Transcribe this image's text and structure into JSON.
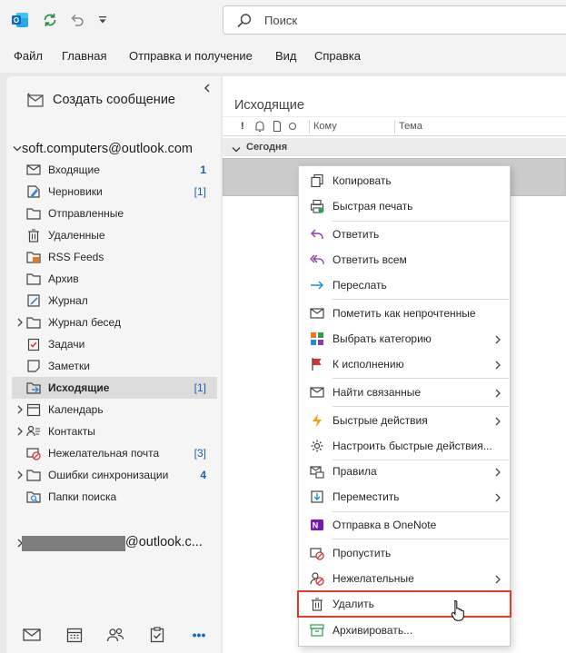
{
  "titlebar": {
    "search_placeholder": "Поиск",
    "icons": [
      "outlook-logo-icon",
      "sync-icon",
      "undo-icon",
      "customize-toolbar-icon"
    ]
  },
  "menu": {
    "items": [
      "Файл",
      "Главная",
      "Отправка и получение",
      "Вид",
      "Справка"
    ]
  },
  "nav": {
    "new_message": "Создать сообщение",
    "account": "soft.computers@outlook.com",
    "folders": [
      {
        "label": "Входящие",
        "count": "1",
        "icon": "inbox-icon"
      },
      {
        "label": "Черновики",
        "count": "[1]",
        "icon": "drafts-icon"
      },
      {
        "label": "Отправленные",
        "count": "",
        "icon": "folder-icon"
      },
      {
        "label": "Удаленные",
        "count": "",
        "icon": "trash-icon"
      },
      {
        "label": "RSS Feeds",
        "count": "",
        "icon": "rss-folder-icon"
      },
      {
        "label": "Архив",
        "count": "",
        "icon": "folder-icon"
      },
      {
        "label": "Журнал",
        "count": "",
        "icon": "journal-icon"
      },
      {
        "label": "Журнал бесед",
        "count": "",
        "icon": "folder-icon"
      },
      {
        "label": "Задачи",
        "count": "",
        "icon": "tasks-icon"
      },
      {
        "label": "Заметки",
        "count": "",
        "icon": "notes-icon"
      },
      {
        "label": "Исходящие",
        "count": "[1]",
        "icon": "outbox-icon"
      },
      {
        "label": "Календарь",
        "count": "",
        "icon": "calendar-icon"
      },
      {
        "label": "Контакты",
        "count": "",
        "icon": "contacts-icon"
      },
      {
        "label": "Нежелательная почта",
        "count": "[3]",
        "icon": "junk-icon"
      },
      {
        "label": "Ошибки синхронизации",
        "count": "4",
        "icon": "folder-icon"
      },
      {
        "label": "Папки поиска",
        "count": "",
        "icon": "search-folder-icon"
      }
    ],
    "second_account_suffix": "@outlook.c...",
    "bottom_icons": [
      "mail-icon",
      "calendar-icon",
      "people-icon",
      "tasks-icon",
      "more-icon"
    ],
    "bottom_more": "•••"
  },
  "list": {
    "title": "Исходящие",
    "columns": {
      "importance": "!",
      "to": "Кому",
      "subject": "Тема"
    },
    "group": "Сегодня"
  },
  "context_menu": {
    "items": [
      {
        "label": "Копировать",
        "icon": "copy-icon"
      },
      {
        "label": "Быстрая печать",
        "icon": "quick-print-icon"
      },
      {
        "label": "Ответить",
        "icon": "reply-icon"
      },
      {
        "label": "Ответить всем",
        "icon": "reply-all-icon"
      },
      {
        "label": "Переслать",
        "icon": "forward-icon"
      },
      {
        "label": "Пометить как непрочтенные",
        "icon": "mark-unread-icon"
      },
      {
        "label": "Выбрать категорию",
        "icon": "categorize-icon"
      },
      {
        "label": "К исполнению",
        "icon": "flag-icon"
      },
      {
        "label": "Найти связанные",
        "icon": "find-related-icon"
      },
      {
        "label": "Быстрые действия",
        "icon": "quick-steps-icon"
      },
      {
        "label": "Настроить быстрые действия...",
        "icon": "gear-icon"
      },
      {
        "label": "Правила",
        "icon": "rules-icon"
      },
      {
        "label": "Переместить",
        "icon": "move-icon"
      },
      {
        "label": "Отправка в OneNote",
        "icon": "onenote-icon"
      },
      {
        "label": "Пропустить",
        "icon": "ignore-icon"
      },
      {
        "label": "Нежелательные",
        "icon": "junk-icon"
      },
      {
        "label": "Удалить",
        "icon": "delete-icon"
      },
      {
        "label": "Архивировать...",
        "icon": "archive-icon"
      }
    ]
  },
  "colors": {
    "accent": "#0f6cbd",
    "highlight_border": "#e23a2b",
    "selected_folder_bg": "#dcdcdc",
    "count_blue": "#1a5fb4"
  }
}
